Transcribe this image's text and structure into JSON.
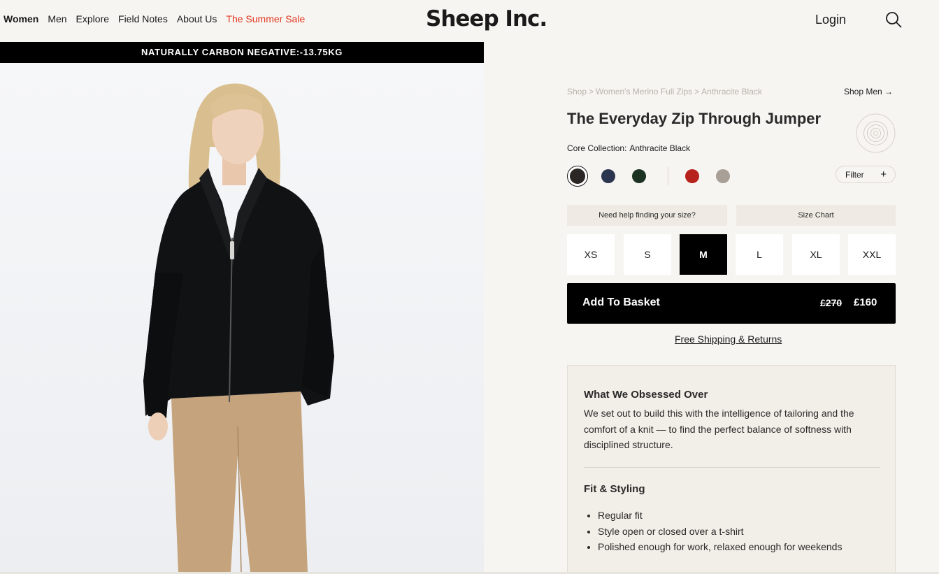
{
  "nav": {
    "items": [
      {
        "label": "Women"
      },
      {
        "label": "Men"
      },
      {
        "label": "Explore"
      },
      {
        "label": "Field Notes"
      },
      {
        "label": "About Us"
      },
      {
        "label": "The Summer Sale"
      }
    ],
    "sale_color": "#e1361e"
  },
  "header": {
    "logo": "Sheep Inc.",
    "login": "Login",
    "search_icon": "search-icon"
  },
  "banner": {
    "text": "NATURALLY CARBON NEGATIVE:-13.75KG"
  },
  "breadcrumb": {
    "items": [
      "Shop",
      ">",
      "Women's Merino Full Zips",
      ">",
      "Anthracite Black"
    ],
    "shop_men": "Shop Men →"
  },
  "product": {
    "title": "The Everyday Zip Through Jumper",
    "collection_label": "Core Collection:",
    "collection_value": "Anthracite Black",
    "badge_icon": "sheep-tag-icon",
    "swatches": [
      {
        "color": "#2a2724",
        "selected": true
      },
      {
        "color": "#2c3550",
        "selected": false
      },
      {
        "color": "#1c3323",
        "selected": false
      },
      {
        "color": "#b8221c",
        "selected": false
      },
      {
        "color": "#a8a096",
        "selected": false
      }
    ],
    "filter": {
      "label": "Filter",
      "icon": "plus-icon"
    }
  },
  "sizing": {
    "help": "Need help finding your size?",
    "chart": "Size Chart",
    "sizes": [
      "XS",
      "S",
      "M",
      "L",
      "XL",
      "XXL"
    ],
    "selected": "M"
  },
  "basket": {
    "label": "Add To Basket",
    "old_price": "£270",
    "new_price": "£160"
  },
  "shipping": "Free Shipping & Returns",
  "details": {
    "heading1": "What We Obsessed Over",
    "description": "We set out to build this with the intelligence of tailoring and the comfort of a knit — to find the perfect balance of softness with disciplined structure.",
    "heading2": "Fit & Styling",
    "bullets": [
      "Regular fit",
      "Style open or closed over a t-shirt",
      "Polished enough for work, relaxed enough for weekends"
    ]
  }
}
